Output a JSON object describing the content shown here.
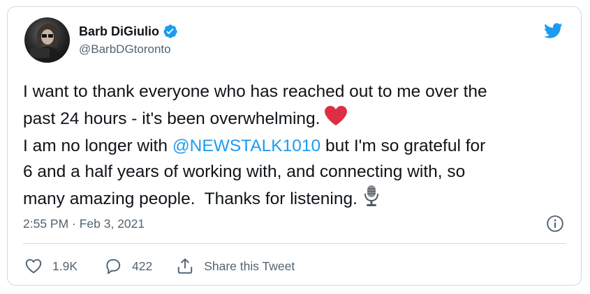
{
  "user": {
    "display_name": "Barb DiGiulio",
    "handle": "@BarbDGtoronto",
    "verified": true
  },
  "tweet": {
    "line1": "I want to thank everyone who has reached out to me over the",
    "line2": "past 24 hours - it's been overwhelming.",
    "line3_before": "I am no longer with ",
    "mention": "@NEWSTALK1010",
    "line3_after": " but I'm so grateful for",
    "line4": "6 and a half years of working with, and connecting with, so",
    "line5": "many amazing people.  Thanks for listening.",
    "emoji_heart": "red-heart",
    "emoji_mic": "studio-microphone"
  },
  "timestamp": "2:55 PM · Feb 3, 2021",
  "actions": {
    "likes": "1.9K",
    "replies": "422",
    "share_label": "Share this Tweet"
  },
  "colors": {
    "accent": "#1d9bf0",
    "heart": "#dd2e44",
    "border": "#cfd9de",
    "muted": "#536471"
  }
}
